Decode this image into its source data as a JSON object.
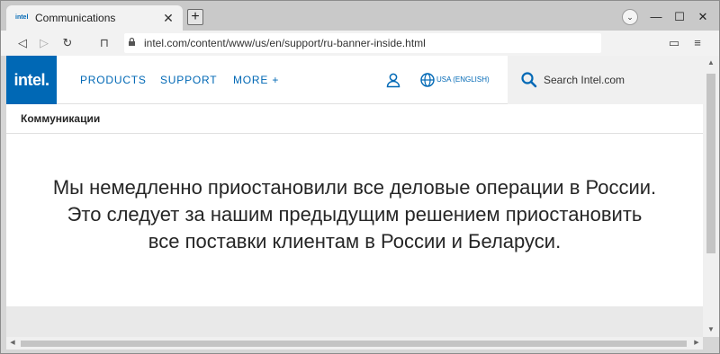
{
  "browser": {
    "tab": {
      "favicon_text": "intel",
      "title": "Communications",
      "close_glyph": "✕"
    },
    "new_tab_glyph": "+",
    "tab_list_glyph": "⌄",
    "window_controls": {
      "minimize": "—",
      "maximize": "☐",
      "close": "✕"
    },
    "nav": {
      "back": "◁",
      "forward": "▷",
      "reload": "↻",
      "bookmark": "⊓"
    },
    "url": "intel.com/content/www/us/en/support/ru-banner-inside.html",
    "right_icons": {
      "wallet": "▭",
      "menu": "≡"
    }
  },
  "header": {
    "logo_text": "intel.",
    "nav_links": [
      "PRODUCTS",
      "SUPPORT",
      "MORE +"
    ],
    "lang_label": "USA (ENGLISH)",
    "search_label": "Search Intel.com"
  },
  "page": {
    "breadcrumb_title": "Коммуникации",
    "statement_lines": [
      "Мы немедленно приостановили все деловые операции в России.",
      "Это следует за нашим предыдущим решением приостановить",
      "все поставки клиентам в России и Беларуси."
    ]
  },
  "colors": {
    "intel_blue": "#0068b5",
    "text": "#262626",
    "search_bg": "#f0f0f0"
  },
  "icons": [
    "user-icon",
    "globe-icon",
    "search-icon",
    "lock-icon"
  ]
}
